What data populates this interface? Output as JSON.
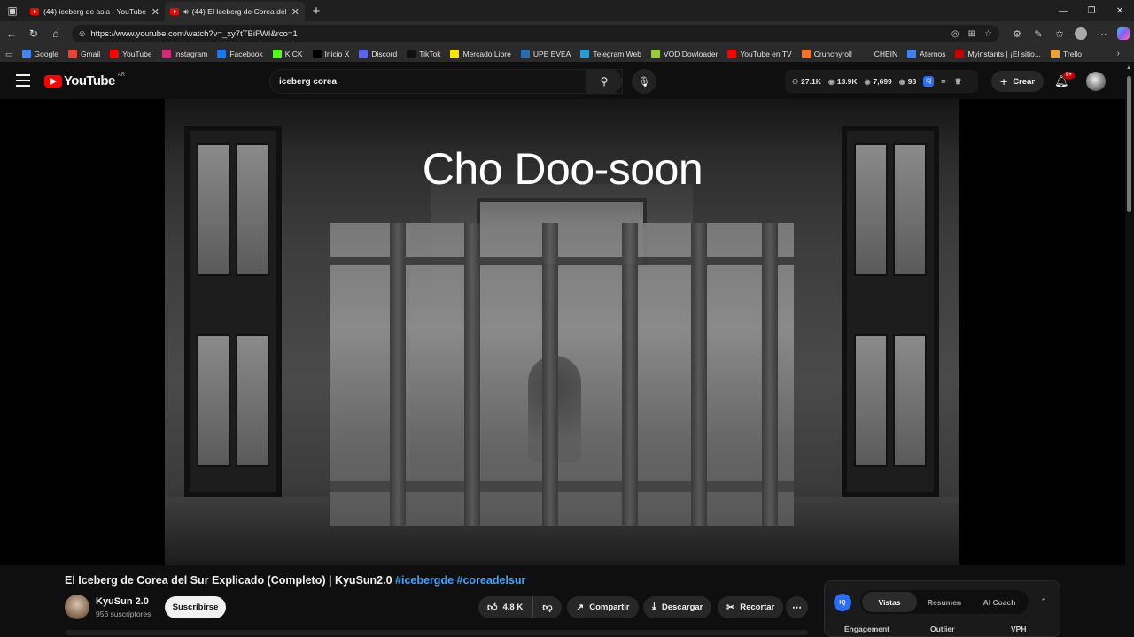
{
  "browser": {
    "tabs": [
      {
        "title": "(44) iceberg de asia - YouTube",
        "active": false
      },
      {
        "title": "(44) El Iceberg de Corea del",
        "active": true
      }
    ],
    "url": "https://www.youtube.com/watch?v=_xy7tTBiFWI&rco=1",
    "bookmarks": [
      {
        "label": "Google",
        "icon": "google-icon",
        "color": "#4285f4"
      },
      {
        "label": "Gmail",
        "icon": "gmail-icon",
        "color": "#ea4335"
      },
      {
        "label": "YouTube",
        "icon": "youtube-icon",
        "color": "#ff0000"
      },
      {
        "label": "Instagram",
        "icon": "instagram-icon",
        "color": "#d62976"
      },
      {
        "label": "Facebook",
        "icon": "facebook-icon",
        "color": "#1877f2"
      },
      {
        "label": "KICK",
        "icon": "kick-icon",
        "color": "#53fc18"
      },
      {
        "label": "Inicio X",
        "icon": "x-icon",
        "color": "#000000"
      },
      {
        "label": "Discord",
        "icon": "discord-icon",
        "color": "#5865f2"
      },
      {
        "label": "TikTok",
        "icon": "tiktok-icon",
        "color": "#111111"
      },
      {
        "label": "Mercado Libre",
        "icon": "mercadolibre-icon",
        "color": "#ffe600"
      },
      {
        "label": "UPE EVEA",
        "icon": "upe-icon",
        "color": "#2b6cb0"
      },
      {
        "label": "Telegram Web",
        "icon": "telegram-icon",
        "color": "#229ed9"
      },
      {
        "label": "VOD Dowloader",
        "icon": "vod-icon",
        "color": "#9acd32"
      },
      {
        "label": "YouTube en TV",
        "icon": "youtube-icon",
        "color": "#ff0000"
      },
      {
        "label": "Crunchyroll",
        "icon": "crunchyroll-icon",
        "color": "#f47521"
      },
      {
        "label": "CHEIN",
        "icon": "folder-icon",
        "color": "#2b2b2b"
      },
      {
        "label": "Aternos",
        "icon": "aternos-icon",
        "color": "#3b82f6"
      },
      {
        "label": "Myinstants | ¡El sitio...",
        "icon": "myinstants-icon",
        "color": "#cc0000"
      },
      {
        "label": "Trello",
        "icon": "trello-icon",
        "color": "#e8a33d"
      }
    ]
  },
  "youtube": {
    "logo_text": "YouTube",
    "country_code": "AR",
    "search_value": "iceberg corea",
    "stats": {
      "subs": "27.1K",
      "views": "13.9K",
      "views2": "7,699",
      "count": "98"
    },
    "create_label": "Crear",
    "notification_badge": "9+"
  },
  "player": {
    "overlay_title": "Cho Doo-soon"
  },
  "video": {
    "title_main": "El Iceberg de Corea del Sur Explicado (Completo) | KyuSun2.0 ",
    "hashtag1": "#icebergde",
    "hashtag2": "#coreadelsur",
    "channel_name": "KyuSun 2.0",
    "subscribers": "956 suscriptores",
    "subscribe_label": "Suscribirse",
    "likes": "4.8 K",
    "share_label": "Compartir",
    "download_label": "Descargar",
    "clip_label": "Recortar"
  },
  "vidiq": {
    "logo": "IQ",
    "tabs": [
      "Vistas",
      "Resumen",
      "AI Coach"
    ],
    "columns": [
      "Engagement",
      "Outlier",
      "VPH"
    ]
  }
}
